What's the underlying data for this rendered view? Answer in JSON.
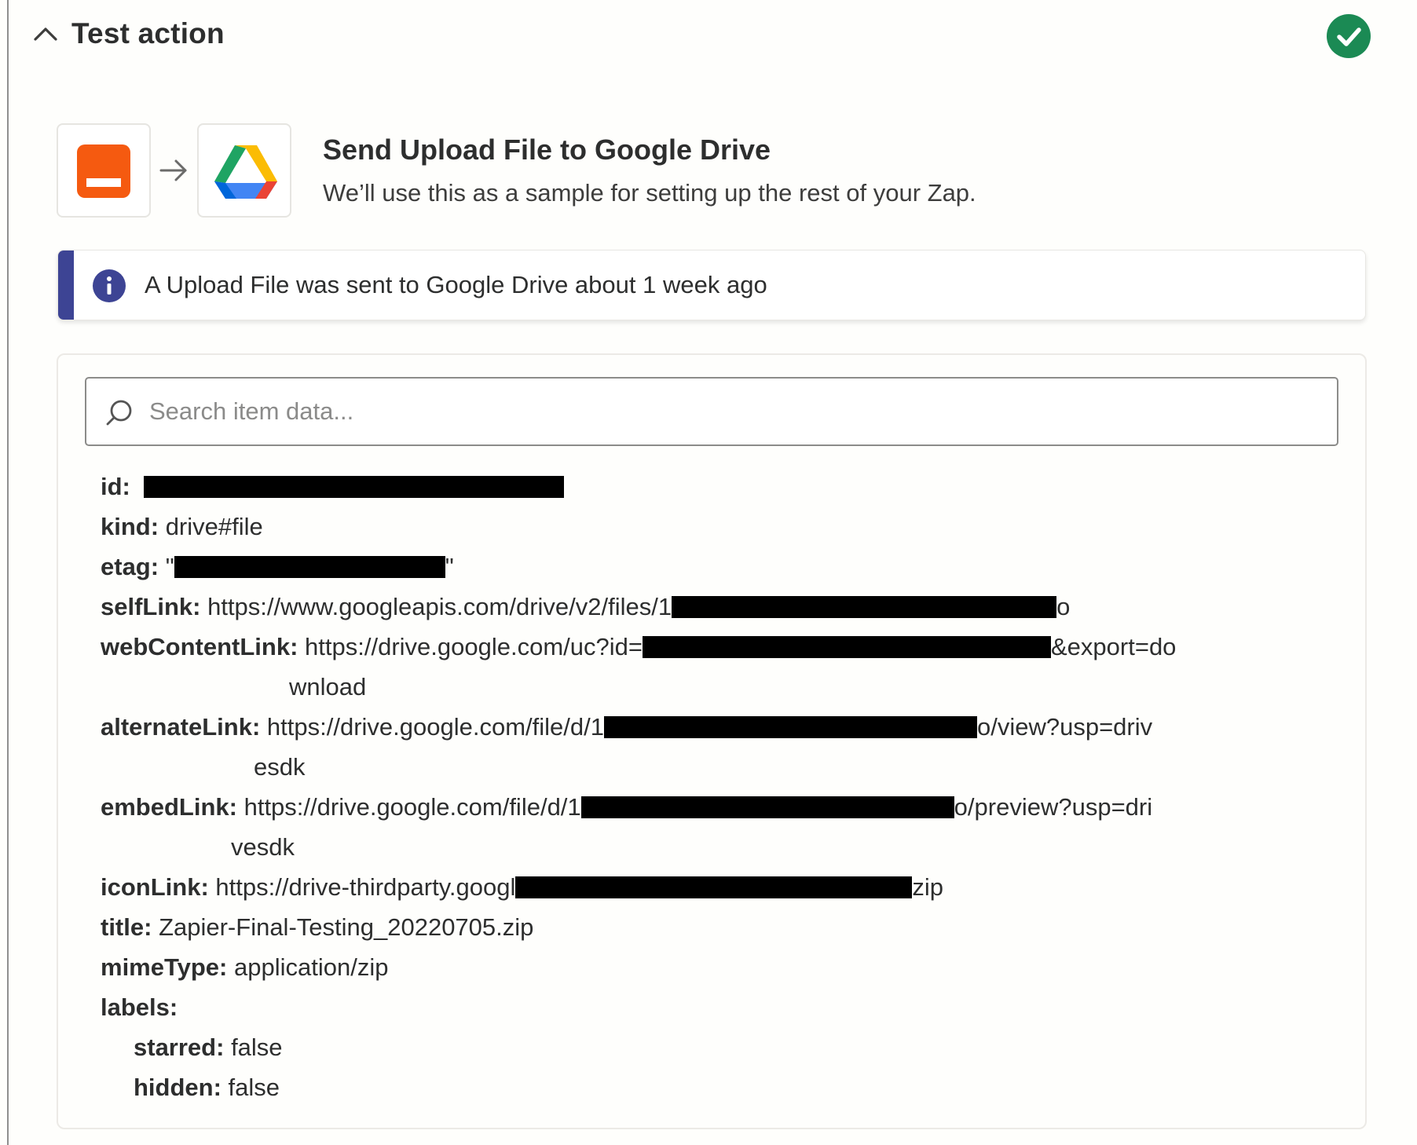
{
  "header": {
    "title": "Test action",
    "status_icon": "check-circle-icon",
    "status_color": "#1b8a54"
  },
  "step": {
    "source_app_icon": "orange-app-icon",
    "target_app_icon": "google-drive-icon",
    "title": "Send Upload File to Google Drive",
    "subtitle": "We’ll use this as a sample for setting up the rest of your Zap."
  },
  "alert": {
    "text": "A Upload File was sent to Google Drive about 1 week ago",
    "accent": "#3d4494"
  },
  "search": {
    "placeholder": "Search item data..."
  },
  "fields": {
    "id": {
      "key": "id:"
    },
    "kind": {
      "key": "kind:",
      "value": "drive#file"
    },
    "etag": {
      "key": "etag:",
      "prefix": "\"",
      "suffix": "\""
    },
    "selfLink": {
      "key": "selfLink:",
      "prefix": "https://www.googleapis.com/drive/v2/files/1",
      "suffix": "o"
    },
    "webContentLink": {
      "key": "webContentLink:",
      "prefix": "https://drive.google.com/uc?id=",
      "suffix": "&export=do",
      "cont": "wnload"
    },
    "alternateLink": {
      "key": "alternateLink:",
      "prefix": "https://drive.google.com/file/d/1",
      "suffix": "o/view?usp=driv",
      "cont": "esdk"
    },
    "embedLink": {
      "key": "embedLink:",
      "prefix": "https://drive.google.com/file/d/1",
      "suffix": "o/preview?usp=dri",
      "cont": "vesdk"
    },
    "iconLink": {
      "key": "iconLink:",
      "prefix": "https://drive-thirdparty.googl",
      "suffix": "zip"
    },
    "title": {
      "key": "title:",
      "value": "Zapier-Final-Testing_20220705.zip"
    },
    "mimeType": {
      "key": "mimeType:",
      "value": "application/zip"
    },
    "labels": {
      "key": "labels:"
    },
    "starred": {
      "key": "starred:",
      "value": "false"
    },
    "hidden": {
      "key": "hidden:",
      "value": "false"
    }
  }
}
